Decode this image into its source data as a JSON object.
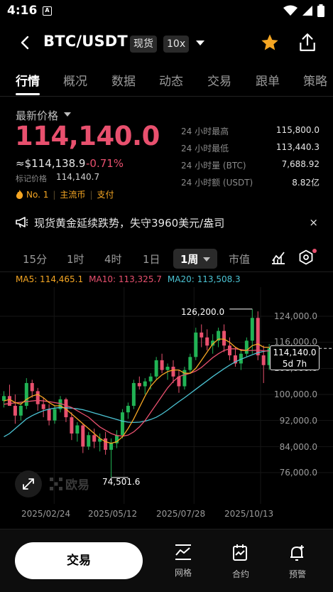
{
  "status": {
    "time": "4:16",
    "app_icon": "A"
  },
  "header": {
    "pair": "BTC/USDT",
    "spot_tag": "现货",
    "leverage_tag": "10x"
  },
  "tabs": [
    "行情",
    "概况",
    "数据",
    "动态",
    "交易",
    "跟单",
    "策略"
  ],
  "price": {
    "label": "最新价格",
    "last": "114,140.0",
    "approx": "≈$114,138.9",
    "change": "-0.71%",
    "mark_label": "标记价格",
    "mark_value": "114,140.7",
    "rank": "No. 1",
    "tag1": "主流币",
    "tag2": "支付"
  },
  "stats": [
    {
      "k": "24 小时最高",
      "v": "115,800.0"
    },
    {
      "k": "24 小时最低",
      "v": "113,440.3"
    },
    {
      "k": "24 小时量 (BTC)",
      "v": "7,688.92"
    },
    {
      "k": "24 小时额 (USDT)",
      "v": "8.82亿"
    }
  ],
  "notice": {
    "text": "现货黄金延续跌势，失守3960美元/盎司",
    "close": "×"
  },
  "intervals": {
    "items": [
      "15分",
      "1时",
      "4时",
      "1日"
    ],
    "active": "1周",
    "market_cap": "市值"
  },
  "ma": {
    "ma5": "MA5: 114,465.1",
    "ma10": "MA10: 113,325.7",
    "ma20": "MA20: 113,508.3"
  },
  "colors": {
    "up": "#21b355",
    "down": "#e8506e",
    "ma5": "#f5a623",
    "ma10": "#e8506e",
    "ma20": "#4bc3d3"
  },
  "chart_data": {
    "type": "candlestick",
    "y_ticks": [
      "124,000.0",
      "116,000.0",
      "108,000.0",
      "100,000.0",
      "92,000.0",
      "84,000.0",
      "76,000.0"
    ],
    "y_tick_values": [
      124000,
      116000,
      108000,
      100000,
      92000,
      84000,
      76000
    ],
    "x_ticks": [
      "2025/02/24",
      "2025/05/12",
      "2025/07/28",
      "2025/10/13"
    ],
    "current_price": "114,140.0",
    "countdown": "5d 7h",
    "high_label": "126,200.0",
    "low_label": "74,501.6",
    "candles": [
      [
        98000,
        101000,
        96000,
        99500
      ],
      [
        99500,
        103000,
        97000,
        96500
      ],
      [
        96500,
        100000,
        91000,
        93500
      ],
      [
        93500,
        97500,
        92000,
        96500
      ],
      [
        96500,
        105000,
        95500,
        103500
      ],
      [
        103500,
        104500,
        99000,
        101000
      ],
      [
        101000,
        102000,
        95000,
        97000
      ],
      [
        97000,
        99000,
        93000,
        95500
      ],
      [
        95500,
        97000,
        90500,
        92000
      ],
      [
        92000,
        96500,
        91000,
        95500
      ],
      [
        95500,
        99500,
        94500,
        98500
      ],
      [
        98500,
        99000,
        91500,
        93000
      ],
      [
        93000,
        94500,
        86000,
        88000
      ],
      [
        88000,
        91500,
        85500,
        90500
      ],
      [
        90500,
        91000,
        82000,
        84000
      ],
      [
        84000,
        88500,
        83000,
        87500
      ],
      [
        87500,
        89500,
        83500,
        85500
      ],
      [
        85500,
        88000,
        82500,
        86500
      ],
      [
        86500,
        88500,
        81500,
        83000
      ],
      [
        83000,
        86500,
        74500,
        85000
      ],
      [
        85000,
        89000,
        83500,
        87500
      ],
      [
        87500,
        95500,
        86500,
        94500
      ],
      [
        94500,
        97500,
        92500,
        96500
      ],
      [
        96500,
        104500,
        95500,
        103500
      ],
      [
        103500,
        105500,
        101500,
        102500
      ],
      [
        102500,
        105000,
        100000,
        104000
      ],
      [
        104000,
        106500,
        101500,
        105500
      ],
      [
        105500,
        111500,
        104500,
        110500
      ],
      [
        110500,
        112500,
        106500,
        107500
      ],
      [
        107500,
        109500,
        104500,
        108500
      ],
      [
        108500,
        110500,
        103500,
        105500
      ],
      [
        105500,
        107500,
        100500,
        102500
      ],
      [
        102500,
        108500,
        101500,
        107500
      ],
      [
        107500,
        112500,
        106500,
        111500
      ],
      [
        111500,
        120500,
        110500,
        119000
      ],
      [
        119000,
        121500,
        114500,
        117500
      ],
      [
        117500,
        120000,
        113500,
        115000
      ],
      [
        115000,
        118500,
        112500,
        116500
      ],
      [
        116500,
        120500,
        114500,
        119500
      ],
      [
        119500,
        121500,
        113000,
        115000
      ],
      [
        115000,
        117500,
        110500,
        112000
      ],
      [
        112000,
        114500,
        108500,
        109500
      ],
      [
        109500,
        113500,
        107500,
        112500
      ],
      [
        112500,
        117500,
        111500,
        116500
      ],
      [
        116500,
        126200,
        112500,
        123500
      ],
      [
        123500,
        125500,
        110500,
        112000
      ],
      [
        112000,
        115000,
        103500,
        109000
      ],
      [
        109000,
        115500,
        107500,
        114140
      ]
    ],
    "ma5": [
      98000,
      98500,
      97500,
      97000,
      98500,
      99500,
      100000,
      99000,
      97500,
      96500,
      96500,
      95500,
      94000,
      92500,
      91000,
      89500,
      88000,
      86500,
      85500,
      85000,
      85500,
      87000,
      89500,
      92500,
      96000,
      99500,
      102500,
      104500,
      106000,
      107000,
      107500,
      107500,
      106500,
      106500,
      108000,
      110500,
      113000,
      115500,
      117000,
      117000,
      116000,
      114500,
      113500,
      113500,
      115000,
      115500,
      114500,
      114465
    ],
    "ma10": [
      97000,
      97200,
      97400,
      97600,
      97800,
      98000,
      98200,
      98000,
      97800,
      97500,
      97200,
      96600,
      96000,
      95000,
      94000,
      93000,
      91500,
      90000,
      89000,
      88000,
      87400,
      87200,
      87500,
      88500,
      90000,
      92000,
      94500,
      97000,
      99500,
      102000,
      104000,
      105500,
      106000,
      106500,
      107200,
      108300,
      109800,
      111300,
      112500,
      113500,
      114000,
      114000,
      113800,
      113500,
      113500,
      113600,
      113400,
      113326
    ],
    "ma20": [
      87000,
      88000,
      89500,
      91000,
      92500,
      93500,
      94300,
      95000,
      95500,
      95800,
      96000,
      95900,
      95800,
      95600,
      95300,
      94800,
      94300,
      93800,
      93300,
      92800,
      92300,
      91800,
      91500,
      91400,
      91500,
      91800,
      92300,
      93000,
      94000,
      95200,
      96500,
      97800,
      99000,
      100300,
      101600,
      102900,
      104200,
      105500,
      106700,
      107900,
      109000,
      110000,
      110800,
      111500,
      112200,
      112800,
      113200,
      113508
    ]
  },
  "bottom": {
    "trade": "交易",
    "grid": "网格",
    "contract": "合约",
    "alert": "预警"
  }
}
